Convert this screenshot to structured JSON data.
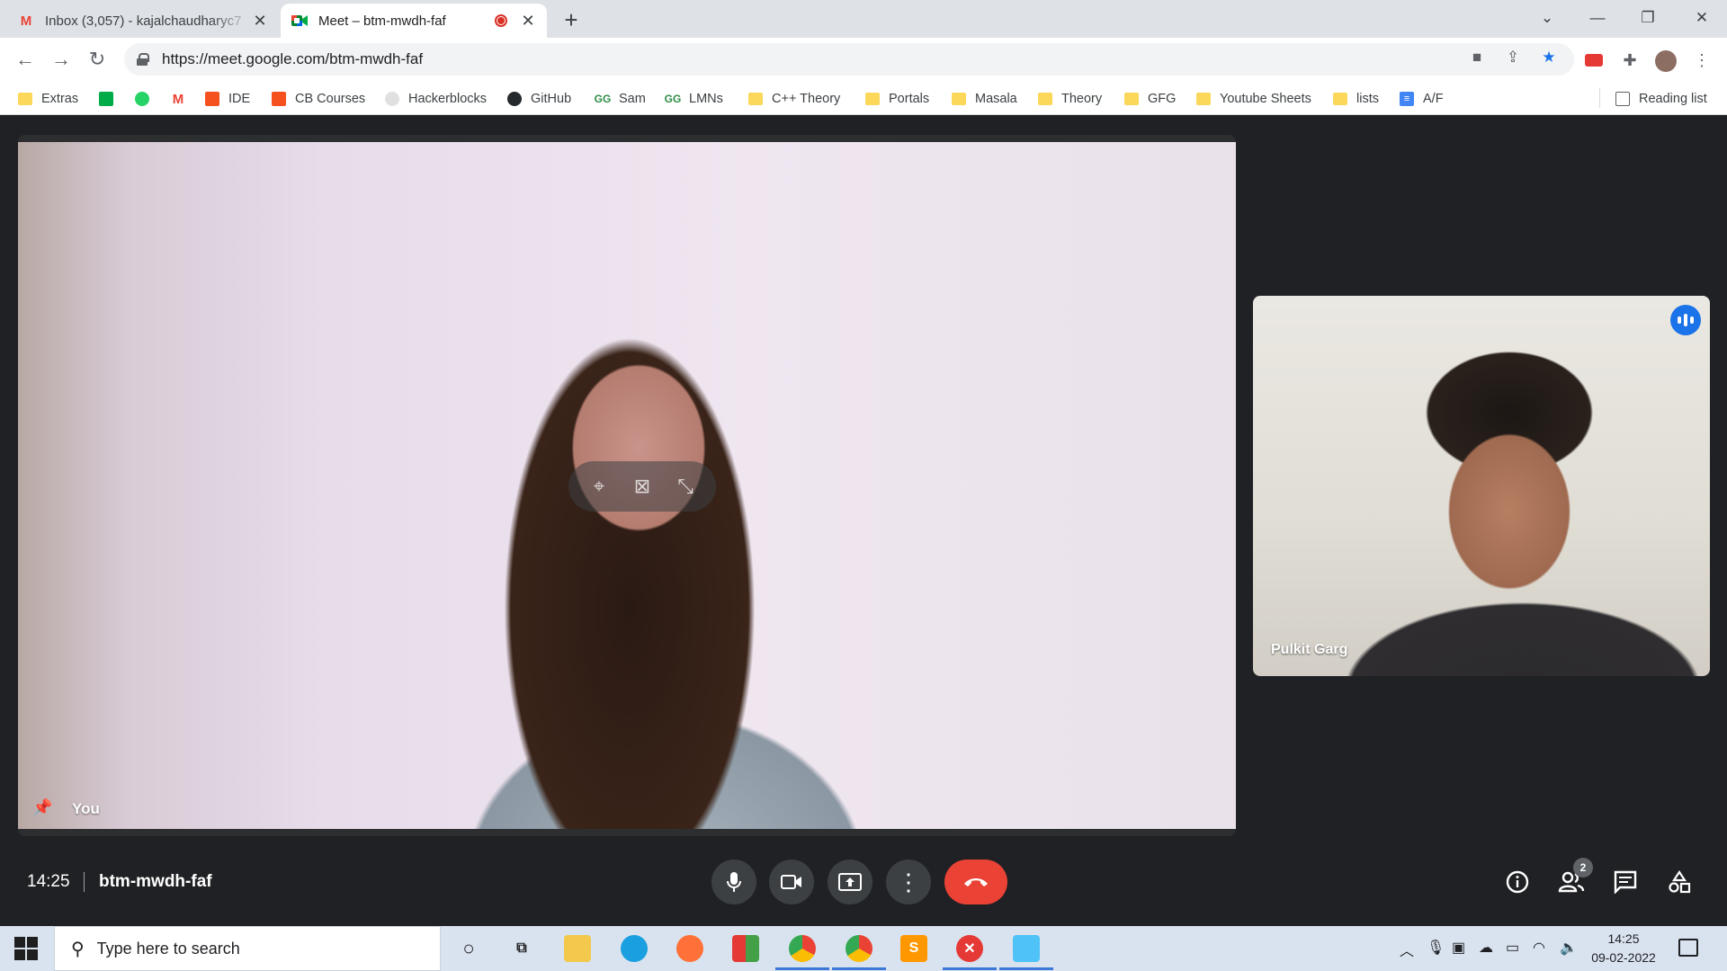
{
  "browser": {
    "tabs": [
      {
        "title": "Inbox (3,057) - kajalchaudharyc7",
        "icon": "gmail-icon",
        "active": false
      },
      {
        "title": "Meet – btm-mwdh-faf",
        "icon": "meet-icon",
        "active": true
      }
    ],
    "url": "https://meet.google.com/btm-mwdh-faf",
    "bookmarks": [
      {
        "label": "Extras",
        "icon": "folder-icon"
      },
      {
        "label": "",
        "icon": "meet-icon"
      },
      {
        "label": "",
        "icon": "whatsapp-icon"
      },
      {
        "label": "",
        "icon": "gmail-icon"
      },
      {
        "label": "IDE",
        "icon": "codingblocks-icon"
      },
      {
        "label": "CB Courses",
        "icon": "codingblocks-icon"
      },
      {
        "label": "Hackerblocks",
        "icon": "hackerblocks-icon"
      },
      {
        "label": "GitHub",
        "icon": "github-icon"
      },
      {
        "label": "Sam",
        "icon": "gfg-icon"
      },
      {
        "label": "LMNs",
        "icon": "gfg-icon"
      },
      {
        "label": "C++ Theory",
        "icon": "folder-icon"
      },
      {
        "label": "Portals",
        "icon": "folder-icon"
      },
      {
        "label": "Masala",
        "icon": "folder-icon"
      },
      {
        "label": "Theory",
        "icon": "folder-icon"
      },
      {
        "label": "GFG",
        "icon": "folder-icon"
      },
      {
        "label": "Youtube Sheets",
        "icon": "folder-icon"
      },
      {
        "label": "lists",
        "icon": "folder-icon"
      },
      {
        "label": "A/F",
        "icon": "docs-icon"
      }
    ],
    "reading_list": "Reading list"
  },
  "meet": {
    "main_participant": "You",
    "side_participant": "Pulkit Garg",
    "time": "14:25",
    "meeting_code": "btm-mwdh-faf",
    "participant_count": "2",
    "colors": {
      "end_call": "#ea4335",
      "speaking": "#1a73e8",
      "control_bg": "#3c4043"
    }
  },
  "taskbar": {
    "search_placeholder": "Type here to search",
    "time": "14:25",
    "date": "09-02-2022"
  }
}
